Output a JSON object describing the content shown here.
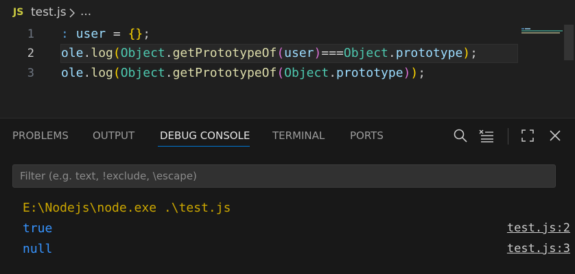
{
  "breadcrumb": {
    "language_badge": "JS",
    "file": "test.js",
    "ellipsis": "..."
  },
  "editor": {
    "current_line": 2,
    "lines": [
      {
        "number": "1",
        "tokens": [
          {
            "t": ": ",
            "c": "kw"
          },
          {
            "t": "user",
            "c": "var"
          },
          {
            "t": " = ",
            "c": "op"
          },
          {
            "t": "{",
            "c": "br1"
          },
          {
            "t": "}",
            "c": "br1"
          },
          {
            "t": ";",
            "c": "pl"
          }
        ]
      },
      {
        "number": "2",
        "tokens": [
          {
            "t": "ole",
            "c": "var"
          },
          {
            "t": ".",
            "c": "pl"
          },
          {
            "t": "log",
            "c": "fn"
          },
          {
            "t": "(",
            "c": "br1"
          },
          {
            "t": "Object",
            "c": "cls"
          },
          {
            "t": ".",
            "c": "pl"
          },
          {
            "t": "getPrototypeOf",
            "c": "fn"
          },
          {
            "t": "(",
            "c": "br2"
          },
          {
            "t": "user",
            "c": "var"
          },
          {
            "t": ")",
            "c": "br2"
          },
          {
            "t": "===",
            "c": "op"
          },
          {
            "t": "Object",
            "c": "cls"
          },
          {
            "t": ".",
            "c": "pl"
          },
          {
            "t": "prototype",
            "c": "var"
          },
          {
            "t": ")",
            "c": "br1"
          },
          {
            "t": ";",
            "c": "pl"
          }
        ]
      },
      {
        "number": "3",
        "tokens": [
          {
            "t": "ole",
            "c": "var"
          },
          {
            "t": ".",
            "c": "pl"
          },
          {
            "t": "log",
            "c": "fn"
          },
          {
            "t": "(",
            "c": "br1"
          },
          {
            "t": "Object",
            "c": "cls"
          },
          {
            "t": ".",
            "c": "pl"
          },
          {
            "t": "getPrototypeOf",
            "c": "fn"
          },
          {
            "t": "(",
            "c": "br2"
          },
          {
            "t": "Object",
            "c": "cls"
          },
          {
            "t": ".",
            "c": "pl"
          },
          {
            "t": "prototype",
            "c": "var"
          },
          {
            "t": ")",
            "c": "br2"
          },
          {
            "t": ")",
            "c": "br1"
          },
          {
            "t": ";",
            "c": "pl"
          }
        ]
      }
    ]
  },
  "panel": {
    "tabs": [
      {
        "label": "PROBLEMS",
        "active": false
      },
      {
        "label": "OUTPUT",
        "active": false
      },
      {
        "label": "DEBUG CONSOLE",
        "active": true
      },
      {
        "label": "TERMINAL",
        "active": false
      },
      {
        "label": "PORTS",
        "active": false
      }
    ],
    "actions": [
      "search-icon",
      "clear-console-icon",
      "maximize-panel-icon",
      "close-icon"
    ],
    "filter_placeholder": "Filter (e.g. text, !exclude, \\escape)",
    "filter_value": "",
    "output": [
      {
        "text": "E:\\Nodejs\\node.exe .\\test.js",
        "kind": "cmd",
        "source": ""
      },
      {
        "text": "true",
        "kind": "val",
        "source": "test.js:2"
      },
      {
        "text": "null",
        "kind": "val",
        "source": "test.js:3"
      }
    ]
  },
  "colors": {
    "accent": "#0078d4",
    "js_badge": "#cbcb41",
    "output_value": "#3794ff",
    "output_command": "#cca700"
  }
}
